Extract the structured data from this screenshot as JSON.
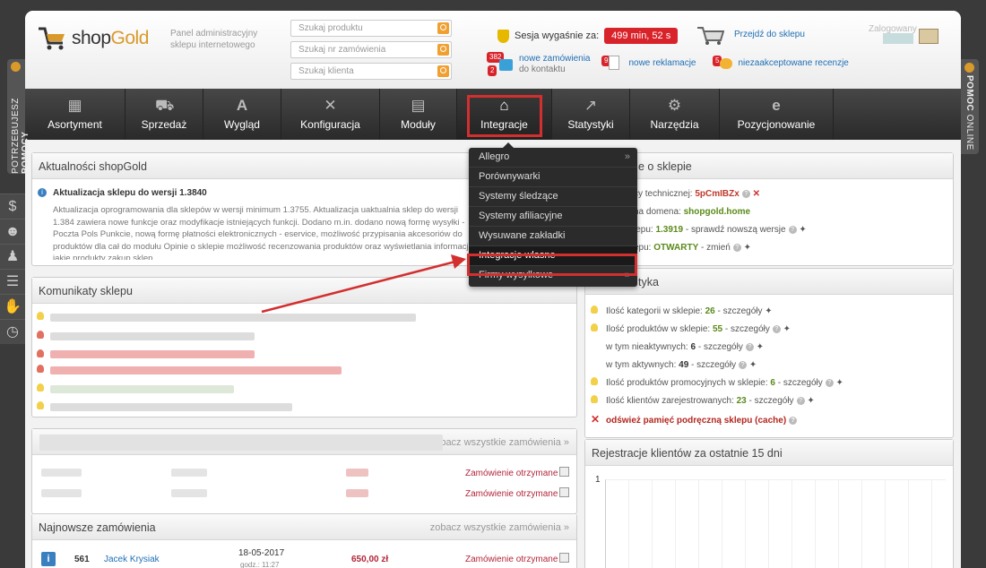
{
  "header": {
    "brand_part1": "shop",
    "brand_part2": "Gold",
    "tagline": "Panel administracyjny sklepu internetowego",
    "search": [
      {
        "placeholder": "Szukaj produktu"
      },
      {
        "placeholder": "Szukaj nr zamówienia"
      },
      {
        "placeholder": "Szukaj klienta"
      }
    ],
    "session_label": "Sesja wygaśnie za:",
    "session_timer": "499 min, 52 s",
    "shop_link": "Przejdź do sklepu",
    "logged_label": "Zalogowany",
    "notifications": {
      "orders_badge": "382",
      "contact_badge": "2",
      "orders_label": "nowe zamówienia",
      "contact_label": "do kontaktu",
      "complaints_badge": "9",
      "complaints_label": "nowe reklamacje",
      "reviews_badge": "5",
      "reviews_label": "niezaakceptowane recenzje"
    }
  },
  "nav": {
    "items": [
      {
        "label": "Asortyment",
        "icon": "basket-icon"
      },
      {
        "label": "Sprzedaż",
        "icon": "cart-icon"
      },
      {
        "label": "Wygląd",
        "icon": "font-icon"
      },
      {
        "label": "Konfiguracja",
        "icon": "tools-icon"
      },
      {
        "label": "Moduły",
        "icon": "modules-icon"
      },
      {
        "label": "Integracje",
        "icon": "integration-icon"
      },
      {
        "label": "Statystyki",
        "icon": "chart-icon"
      },
      {
        "label": "Narzędzia",
        "icon": "gear-icon"
      },
      {
        "label": "Pozycjonowanie",
        "icon": "ie-icon"
      }
    ]
  },
  "dropdown": {
    "items": [
      {
        "label": "Allegro",
        "arrow": "»"
      },
      {
        "label": "Porównywarki",
        "arrow": ""
      },
      {
        "label": "Systemy śledzące",
        "arrow": ""
      },
      {
        "label": "Systemy afiliacyjne",
        "arrow": ""
      },
      {
        "label": "Wysuwane zakładki",
        "arrow": ""
      },
      {
        "label": "Integracje własne",
        "arrow": ""
      },
      {
        "label": "Firmy wysyłkowe",
        "arrow": "»"
      }
    ]
  },
  "side": {
    "left_label_1": "POTRZEBUJESZ",
    "left_label_2": "POMOCY",
    "right_label_1": "POMOC",
    "right_label_2": "ONLINE"
  },
  "news": {
    "title": "Aktualności shopGold",
    "headline": "Aktualizacja sklepu do wersji 1.3840",
    "body": "Aktualizacja oprogramowania dla sklepów w wersji minimum 1.3755. Aktualizacja uaktualnia sklep do wersji 1.384 zawiera nowe funkcje oraz modyfikacje istniejących funkcji. Dodano m.in. dodano nową formę wysyłki - Poczta Pols Punkcie, nową formę płatności elektronicznych - eservice, możliwość przypisania akcesoriów do produktów dla cał do modułu Opinie o sklepie możliwość recenzowania produktów oraz wyświetlania informacji jakie produkty zakup sklep."
  },
  "messages": {
    "title": "Komunikaty sklepu"
  },
  "orders_top": {
    "more": "zobacz wszystkie zamówienia »",
    "status": [
      "Zamówienie otrzymane",
      "Zamówienie otrzymane"
    ]
  },
  "newest_orders": {
    "title": "Najnowsze zamówienia",
    "more": "zobacz wszystkie zamówienia »",
    "rows": [
      {
        "id": "561",
        "customer": "Jacek Krysiak",
        "date": "18-05-2017",
        "time": "godz.: 11:27",
        "amount": "650,00 zł",
        "status": "Zamówienie otrzymane"
      }
    ]
  },
  "shop_info": {
    "title_fragment": "e o sklepie",
    "support_label": "cy technicznej:",
    "support_code": "5pCmIBZx",
    "domain_label": "na domena:",
    "domain_value": "shopgold.home",
    "version_label": "lepu:",
    "version_value": "1.3919",
    "version_check": "sprawdź nowszą wersje",
    "status_label": "epu:",
    "status_value": "OTWARTY",
    "status_change": "zmień"
  },
  "stats": {
    "title_fragment": "tyka",
    "lines": [
      {
        "label": "Ilość kategorii w sklepie:",
        "value": "26",
        "suffix": "szczegóły"
      },
      {
        "label": "Ilość produktów w sklepie:",
        "value": "55",
        "suffix": "szczegóły"
      },
      {
        "label": "w tym nieaktywnych:",
        "value": "6",
        "suffix": "szczegóły"
      },
      {
        "label": "w tym aktywnych:",
        "value": "49",
        "suffix": "szczegóły"
      },
      {
        "label": "Ilość produktów promocyjnych w sklepie:",
        "value": "6",
        "suffix": "szczegóły"
      },
      {
        "label": "Ilość klientów zarejestrowanych:",
        "value": "23",
        "suffix": "szczegóły"
      }
    ],
    "cache": "odśwież pamięć podręczną sklepu (cache)"
  },
  "registrations": {
    "title": "Rejestracje klientów za ostatnie 15 dni",
    "y_tick": "1"
  }
}
